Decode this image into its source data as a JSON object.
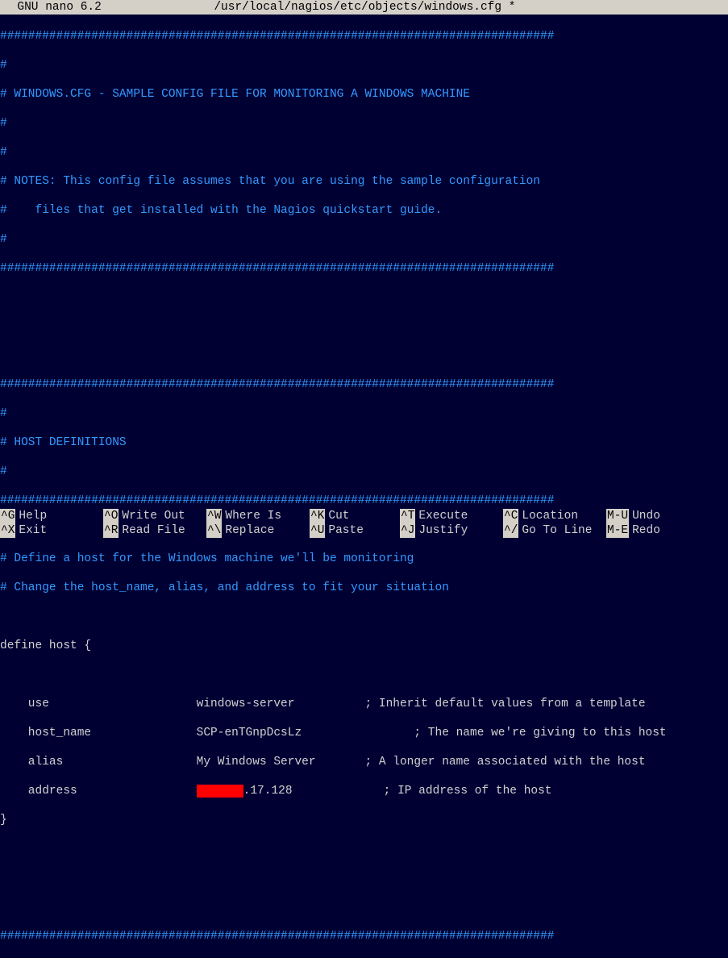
{
  "titlebar": {
    "app": "  GNU nano 6.2",
    "filepath": "/usr/local/nagios/etc/objects/windows.cfg *"
  },
  "lines": {
    "hr": "###############################################################################",
    "hr2": "###############################################################################",
    "c1": "#",
    "c_title": "# WINDOWS.CFG - SAMPLE CONFIG FILE FOR MONITORING A WINDOWS MACHINE",
    "c_notes1": "# NOTES: This config file assumes that you are using the sample configuration",
    "c_notes2": "#    files that get installed with the Nagios quickstart guide.",
    "c_hostdef": "# HOST DEFINITIONS",
    "c_def1": "# Define a host for the Windows machine we'll be monitoring",
    "c_def2": "# Change the host_name, alias, and address to fit your situation",
    "define": "define host {",
    "use": "    use                     windows-server          ; Inherit default values from a template",
    "hostname": "    host_name               SCP-enTGnpDcsLz                ; The name we're giving to this host",
    "alias": "    alias                   My Windows Server       ; A longer name associated with the host",
    "addr_pre": "    address                 ",
    "addr_post": ".17.128             ; IP address of the host",
    "close": "}"
  },
  "shortcuts": {
    "row1": [
      {
        "key": "^G",
        "label": "Help"
      },
      {
        "key": "^O",
        "label": "Write Out"
      },
      {
        "key": "^W",
        "label": "Where Is"
      },
      {
        "key": "^K",
        "label": "Cut"
      },
      {
        "key": "^T",
        "label": "Execute"
      },
      {
        "key": "^C",
        "label": "Location"
      },
      {
        "key": "M-U",
        "label": "Undo"
      }
    ],
    "row2": [
      {
        "key": "^X",
        "label": "Exit"
      },
      {
        "key": "^R",
        "label": "Read File"
      },
      {
        "key": "^\\",
        "label": "Replace"
      },
      {
        "key": "^U",
        "label": "Paste"
      },
      {
        "key": "^J",
        "label": "Justify"
      },
      {
        "key": "^/",
        "label": "Go To Line"
      },
      {
        "key": "M-E",
        "label": "Redo"
      }
    ]
  }
}
